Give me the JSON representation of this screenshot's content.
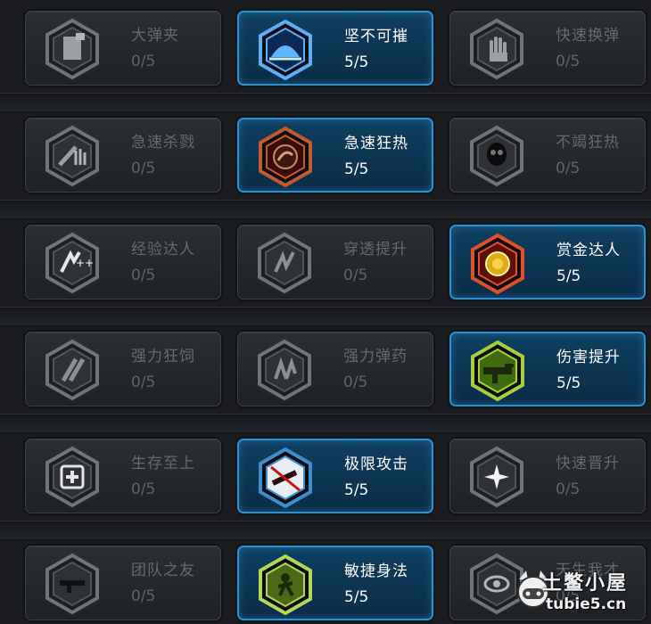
{
  "skills": [
    {
      "name": "大弹夹",
      "level": "0/5",
      "active": false,
      "icon": "magazine-icon"
    },
    {
      "name": "坚不可摧",
      "level": "5/5",
      "active": true,
      "icon": "helmet-icon"
    },
    {
      "name": "快速换弹",
      "level": "0/5",
      "active": false,
      "icon": "hand-icon"
    },
    {
      "name": "急速杀戮",
      "level": "0/5",
      "active": false,
      "icon": "hand-knife-icon"
    },
    {
      "name": "急速狂热",
      "level": "5/5",
      "active": true,
      "icon": "fist-icon"
    },
    {
      "name": "不竭狂热",
      "level": "0/5",
      "active": false,
      "icon": "skull-icon"
    },
    {
      "name": "经验达人",
      "level": "0/5",
      "active": false,
      "icon": "experience-icon"
    },
    {
      "name": "穿透提升",
      "level": "0/5",
      "active": false,
      "icon": "penetration-icon"
    },
    {
      "name": "赏金达人",
      "level": "5/5",
      "active": true,
      "icon": "coin-icon"
    },
    {
      "name": "强力狂饲",
      "level": "0/5",
      "active": false,
      "icon": "power-frenzy-icon"
    },
    {
      "name": "强力弹药",
      "level": "0/5",
      "active": false,
      "icon": "power-ammo-icon"
    },
    {
      "name": "伤害提升",
      "level": "5/5",
      "active": true,
      "icon": "rifle-icon"
    },
    {
      "name": "生存至上",
      "level": "0/5",
      "active": false,
      "icon": "medkit-icon"
    },
    {
      "name": "极限攻击",
      "level": "5/5",
      "active": true,
      "icon": "soldier-attack-icon"
    },
    {
      "name": "快速晋升",
      "level": "0/5",
      "active": false,
      "icon": "star-burst-icon"
    },
    {
      "name": "团队之友",
      "level": "0/5",
      "active": false,
      "icon": "team-rifle-icon"
    },
    {
      "name": "敏捷身法",
      "level": "5/5",
      "active": true,
      "icon": "agile-soldier-icon"
    },
    {
      "name": "天生我才",
      "level": "0/5",
      "active": false,
      "icon": "eye-icon"
    }
  ],
  "watermark": {
    "title": "土鳖小屋",
    "url": "tubie5.cn",
    "icon": "controller-icon"
  },
  "colors": {
    "active_border": "#2f8fcf",
    "active_fill": "#0f3f60",
    "inactive_fill": "#23272b",
    "inactive_text": "#646a70"
  }
}
